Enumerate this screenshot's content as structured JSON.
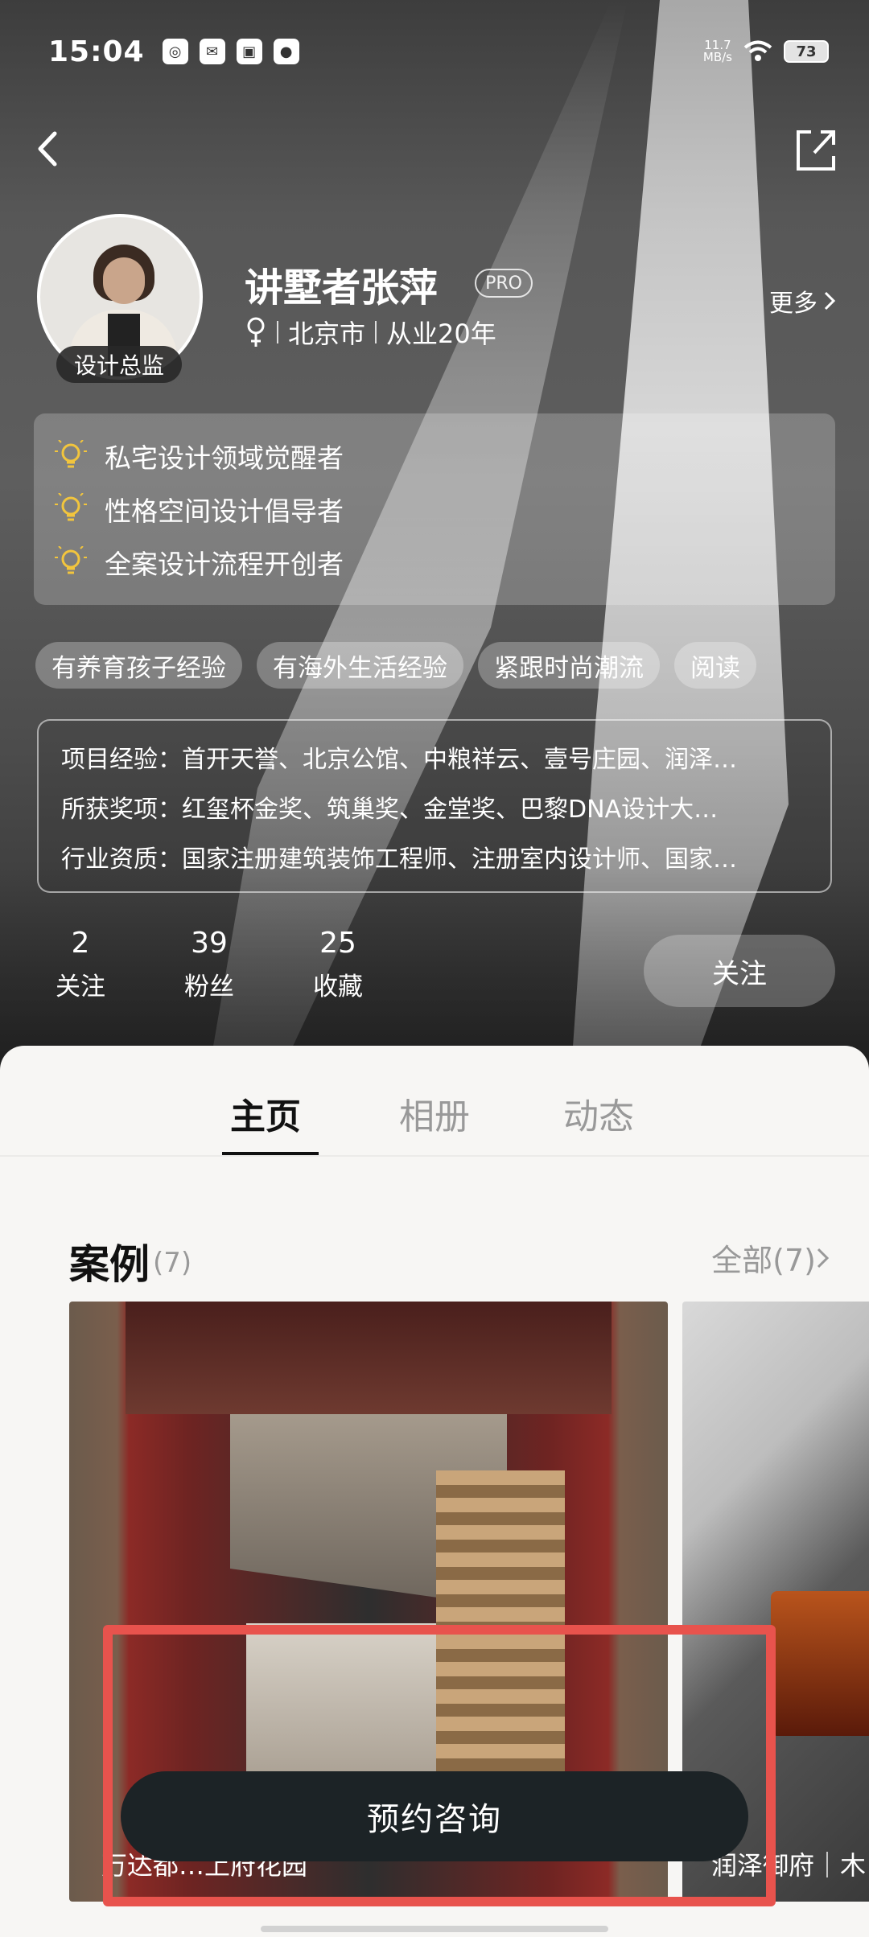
{
  "status_bar": {
    "time": "15:04",
    "net_speed_top": "11.7",
    "net_speed_bottom": "MB/s",
    "battery": "73"
  },
  "profile": {
    "name": "讲墅者张萍",
    "pro_badge": "PRO",
    "role": "设计总监",
    "city": "北京市",
    "experience": "从业20年",
    "more": "更多",
    "traits": [
      "私宅设计领域觉醒者",
      "性格空间设计倡导者",
      "全案设计流程开创者"
    ],
    "tags": [
      "有养育孩子经验",
      "有海外生活经验",
      "紧跟时尚潮流",
      "阅读"
    ],
    "info": [
      "项目经验：首开天誉、北京公馆、中粮祥云、壹号庄园、润泽…",
      "所获奖项：红玺杯金奖、筑巢奖、金堂奖、巴黎DNA设计大…",
      "行业资质：国家注册建筑装饰工程师、注册室内设计师、国家…"
    ],
    "stats": [
      {
        "value": "2",
        "label": "关注"
      },
      {
        "value": "39",
        "label": "粉丝"
      },
      {
        "value": "25",
        "label": "收藏"
      }
    ],
    "follow_button": "关注"
  },
  "tabs": [
    "主页",
    "相册",
    "动态"
  ],
  "active_tab": "主页",
  "cases": {
    "title": "案例",
    "count": "(7)",
    "see_all": "全部(7)",
    "items": [
      {
        "caption": "万达都…上府花园"
      },
      {
        "caption": "润泽御府｜木"
      }
    ]
  },
  "cta": "预约咨询",
  "colors": {
    "highlight": "#e8534d",
    "cta_bg": "#1c2326",
    "bulb": "#f2c53d"
  }
}
